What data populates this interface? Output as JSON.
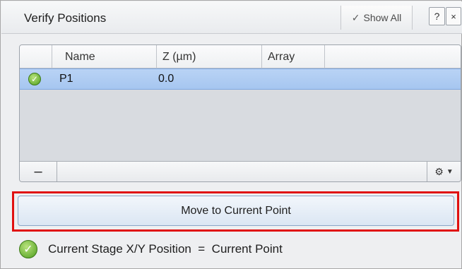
{
  "panel": {
    "title": "Verify Positions",
    "show_all_label": "Show All",
    "help_label": "?",
    "close_label": "×"
  },
  "table": {
    "columns": [
      "Name",
      "Z (µm)",
      "Array"
    ],
    "rows": [
      {
        "status": "ok",
        "name": "P1",
        "z": "0.0",
        "array": ""
      }
    ],
    "remove_label": "–"
  },
  "actions": {
    "move_button_label": "Move to Current Point"
  },
  "status": {
    "text": "Current Stage X/Y Position  =  Current Point"
  },
  "colors": {
    "selection": "#a6c6f0",
    "highlight_border": "#e01010",
    "ok_green": "#4e9e1e"
  }
}
